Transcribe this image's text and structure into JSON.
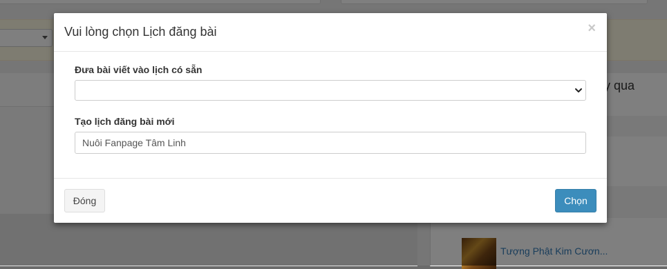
{
  "background": {
    "right_panel_text": "y qua",
    "post_title": "Tượng Phật Kim Cươn..."
  },
  "modal": {
    "title": "Vui lòng chọn Lịch đăng bài",
    "close_symbol": "×",
    "existing_schedule_label": "Đưa bài viết vào lịch có sẵn",
    "existing_schedule_value": "",
    "new_schedule_label": "Tạo lịch đăng bài mới",
    "new_schedule_value": "Nuôi Fanpage Tâm Linh",
    "close_button": "Đóng",
    "choose_button": "Chọn"
  },
  "colors": {
    "primary": "#3c8dbc",
    "backdrop": "rgba(0,0,0,0.5)",
    "warning_bar": "#fcf8e3"
  },
  "icons": {
    "select_caret": "chevron-down-icon",
    "close": "close-icon"
  }
}
